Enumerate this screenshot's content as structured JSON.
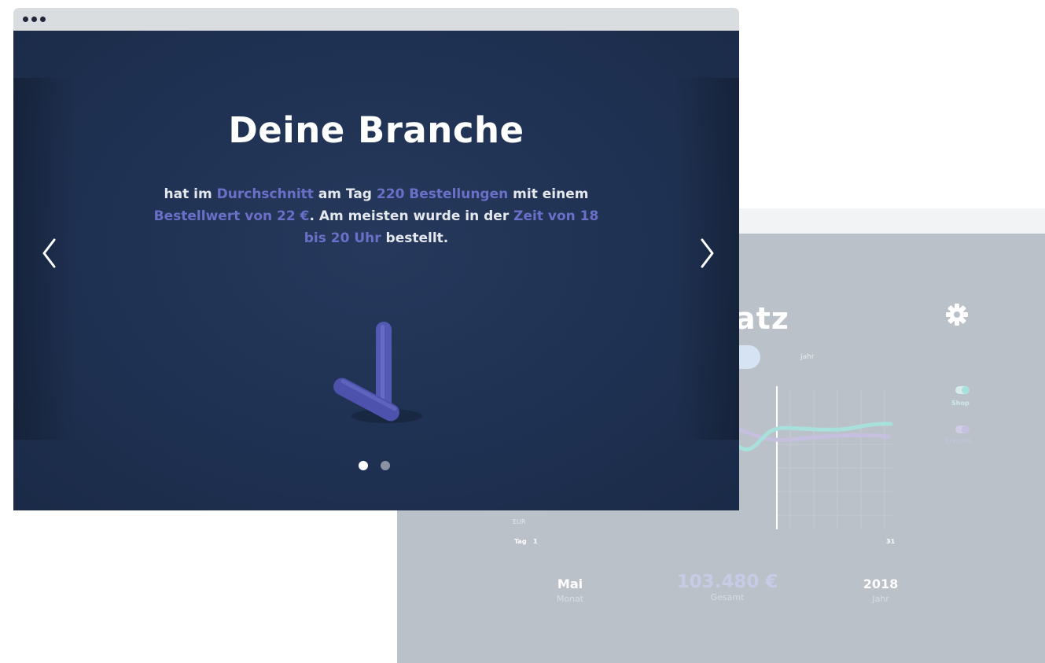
{
  "dashboard": {
    "title": "atz",
    "tabs": {
      "active": "",
      "other": "Jahr"
    },
    "legend": {
      "shop": "Shop",
      "branche": "Branche"
    },
    "chart": {
      "unit": "EUR",
      "x_unit": "Tag",
      "x_start": "1",
      "x_end": "31"
    },
    "stats": {
      "month": {
        "value": "Mai",
        "label": "Monat"
      },
      "total": {
        "value": "103.480 €",
        "label": "Gesamt"
      },
      "year": {
        "value": "2018",
        "label": "Jahr"
      }
    },
    "colors": {
      "shop_line": "#a8e0dc",
      "branche_line": "#c5bfe0",
      "background": "#bbc1c9"
    },
    "icons": {
      "settings": "gear-icon"
    }
  },
  "slider": {
    "heading": "Deine Branche",
    "text": {
      "p1": "hat im ",
      "h1": "Durchschnitt",
      "p2": " am Tag ",
      "h2": "220 Bestellungen",
      "p3": " mit einem ",
      "h3": "Bestellwert von 22 €",
      "p4": ". Am meisten wurde in der ",
      "h4": "Zeit von 18 bis 20 Uhr",
      "p5": " bestellt."
    },
    "prev_icon": "chevron-left-icon",
    "next_icon": "chevron-right-icon",
    "pager": {
      "count": 2,
      "active": 1
    },
    "colors": {
      "background": "#1f3152",
      "highlight": "#6a6fc7",
      "sculpture": "#5459b3"
    }
  }
}
